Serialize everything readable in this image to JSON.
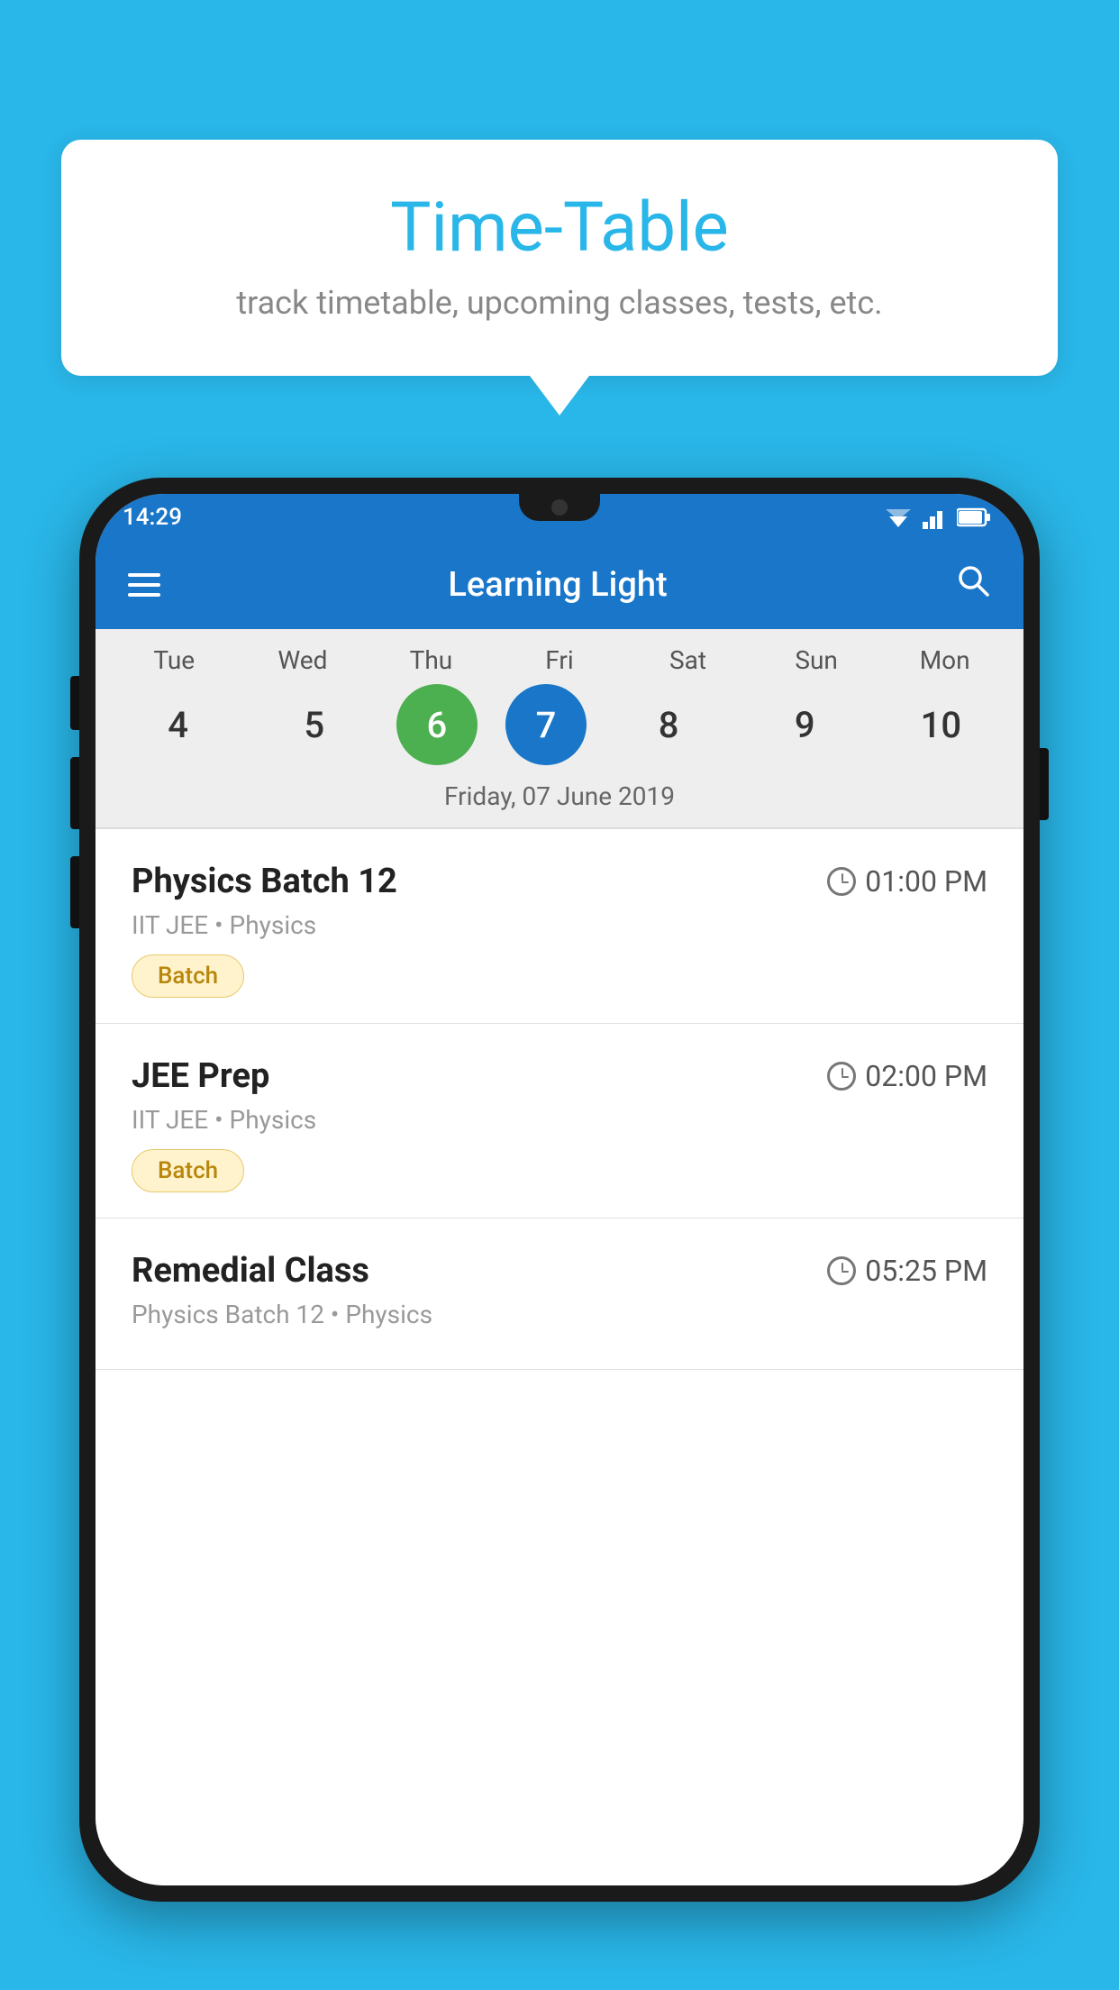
{
  "background_color": "#29b6e8",
  "bubble": {
    "title": "Time-Table",
    "subtitle": "track timetable, upcoming classes, tests, etc."
  },
  "app": {
    "name": "Learning Light",
    "status_time": "14:29"
  },
  "calendar": {
    "selected_date_label": "Friday, 07 June 2019",
    "days": [
      {
        "label": "Tue",
        "num": "4",
        "state": "normal"
      },
      {
        "label": "Wed",
        "num": "5",
        "state": "normal"
      },
      {
        "label": "Thu",
        "num": "6",
        "state": "today"
      },
      {
        "label": "Fri",
        "num": "7",
        "state": "selected"
      },
      {
        "label": "Sat",
        "num": "8",
        "state": "normal"
      },
      {
        "label": "Sun",
        "num": "9",
        "state": "normal"
      },
      {
        "label": "Mon",
        "num": "10",
        "state": "normal"
      }
    ]
  },
  "schedule": [
    {
      "title": "Physics Batch 12",
      "time": "01:00 PM",
      "subtitle": "IIT JEE • Physics",
      "tag": "Batch"
    },
    {
      "title": "JEE Prep",
      "time": "02:00 PM",
      "subtitle": "IIT JEE • Physics",
      "tag": "Batch"
    },
    {
      "title": "Remedial Class",
      "time": "05:25 PM",
      "subtitle": "Physics Batch 12 • Physics",
      "tag": ""
    }
  ],
  "labels": {
    "menu": "menu",
    "search": "search"
  }
}
